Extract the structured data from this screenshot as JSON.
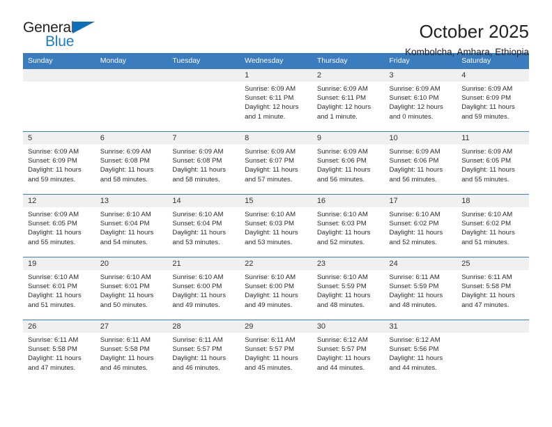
{
  "brand": {
    "name_top": "General",
    "name_bottom": "Blue",
    "flag_icon": "blue-triangle-flag",
    "accent_color": "#1a7ec8",
    "header_color": "#3a7cbe"
  },
  "header": {
    "month_title": "October 2025",
    "location": "Kombolcha, Amhara, Ethiopia"
  },
  "weekdays": [
    "Sunday",
    "Monday",
    "Tuesday",
    "Wednesday",
    "Thursday",
    "Friday",
    "Saturday"
  ],
  "weeks": [
    [
      {
        "day": "",
        "empty": true
      },
      {
        "day": "",
        "empty": true
      },
      {
        "day": "",
        "empty": true
      },
      {
        "day": "1",
        "sunrise": "Sunrise: 6:09 AM",
        "sunset": "Sunset: 6:11 PM",
        "daylight": "Daylight: 12 hours and 1 minute."
      },
      {
        "day": "2",
        "sunrise": "Sunrise: 6:09 AM",
        "sunset": "Sunset: 6:11 PM",
        "daylight": "Daylight: 12 hours and 1 minute."
      },
      {
        "day": "3",
        "sunrise": "Sunrise: 6:09 AM",
        "sunset": "Sunset: 6:10 PM",
        "daylight": "Daylight: 12 hours and 0 minutes."
      },
      {
        "day": "4",
        "sunrise": "Sunrise: 6:09 AM",
        "sunset": "Sunset: 6:09 PM",
        "daylight": "Daylight: 11 hours and 59 minutes."
      }
    ],
    [
      {
        "day": "5",
        "sunrise": "Sunrise: 6:09 AM",
        "sunset": "Sunset: 6:09 PM",
        "daylight": "Daylight: 11 hours and 59 minutes."
      },
      {
        "day": "6",
        "sunrise": "Sunrise: 6:09 AM",
        "sunset": "Sunset: 6:08 PM",
        "daylight": "Daylight: 11 hours and 58 minutes."
      },
      {
        "day": "7",
        "sunrise": "Sunrise: 6:09 AM",
        "sunset": "Sunset: 6:08 PM",
        "daylight": "Daylight: 11 hours and 58 minutes."
      },
      {
        "day": "8",
        "sunrise": "Sunrise: 6:09 AM",
        "sunset": "Sunset: 6:07 PM",
        "daylight": "Daylight: 11 hours and 57 minutes."
      },
      {
        "day": "9",
        "sunrise": "Sunrise: 6:09 AM",
        "sunset": "Sunset: 6:06 PM",
        "daylight": "Daylight: 11 hours and 56 minutes."
      },
      {
        "day": "10",
        "sunrise": "Sunrise: 6:09 AM",
        "sunset": "Sunset: 6:06 PM",
        "daylight": "Daylight: 11 hours and 56 minutes."
      },
      {
        "day": "11",
        "sunrise": "Sunrise: 6:09 AM",
        "sunset": "Sunset: 6:05 PM",
        "daylight": "Daylight: 11 hours and 55 minutes."
      }
    ],
    [
      {
        "day": "12",
        "sunrise": "Sunrise: 6:09 AM",
        "sunset": "Sunset: 6:05 PM",
        "daylight": "Daylight: 11 hours and 55 minutes."
      },
      {
        "day": "13",
        "sunrise": "Sunrise: 6:10 AM",
        "sunset": "Sunset: 6:04 PM",
        "daylight": "Daylight: 11 hours and 54 minutes."
      },
      {
        "day": "14",
        "sunrise": "Sunrise: 6:10 AM",
        "sunset": "Sunset: 6:04 PM",
        "daylight": "Daylight: 11 hours and 53 minutes."
      },
      {
        "day": "15",
        "sunrise": "Sunrise: 6:10 AM",
        "sunset": "Sunset: 6:03 PM",
        "daylight": "Daylight: 11 hours and 53 minutes."
      },
      {
        "day": "16",
        "sunrise": "Sunrise: 6:10 AM",
        "sunset": "Sunset: 6:03 PM",
        "daylight": "Daylight: 11 hours and 52 minutes."
      },
      {
        "day": "17",
        "sunrise": "Sunrise: 6:10 AM",
        "sunset": "Sunset: 6:02 PM",
        "daylight": "Daylight: 11 hours and 52 minutes."
      },
      {
        "day": "18",
        "sunrise": "Sunrise: 6:10 AM",
        "sunset": "Sunset: 6:02 PM",
        "daylight": "Daylight: 11 hours and 51 minutes."
      }
    ],
    [
      {
        "day": "19",
        "sunrise": "Sunrise: 6:10 AM",
        "sunset": "Sunset: 6:01 PM",
        "daylight": "Daylight: 11 hours and 51 minutes."
      },
      {
        "day": "20",
        "sunrise": "Sunrise: 6:10 AM",
        "sunset": "Sunset: 6:01 PM",
        "daylight": "Daylight: 11 hours and 50 minutes."
      },
      {
        "day": "21",
        "sunrise": "Sunrise: 6:10 AM",
        "sunset": "Sunset: 6:00 PM",
        "daylight": "Daylight: 11 hours and 49 minutes."
      },
      {
        "day": "22",
        "sunrise": "Sunrise: 6:10 AM",
        "sunset": "Sunset: 6:00 PM",
        "daylight": "Daylight: 11 hours and 49 minutes."
      },
      {
        "day": "23",
        "sunrise": "Sunrise: 6:10 AM",
        "sunset": "Sunset: 5:59 PM",
        "daylight": "Daylight: 11 hours and 48 minutes."
      },
      {
        "day": "24",
        "sunrise": "Sunrise: 6:11 AM",
        "sunset": "Sunset: 5:59 PM",
        "daylight": "Daylight: 11 hours and 48 minutes."
      },
      {
        "day": "25",
        "sunrise": "Sunrise: 6:11 AM",
        "sunset": "Sunset: 5:58 PM",
        "daylight": "Daylight: 11 hours and 47 minutes."
      }
    ],
    [
      {
        "day": "26",
        "sunrise": "Sunrise: 6:11 AM",
        "sunset": "Sunset: 5:58 PM",
        "daylight": "Daylight: 11 hours and 47 minutes."
      },
      {
        "day": "27",
        "sunrise": "Sunrise: 6:11 AM",
        "sunset": "Sunset: 5:58 PM",
        "daylight": "Daylight: 11 hours and 46 minutes."
      },
      {
        "day": "28",
        "sunrise": "Sunrise: 6:11 AM",
        "sunset": "Sunset: 5:57 PM",
        "daylight": "Daylight: 11 hours and 46 minutes."
      },
      {
        "day": "29",
        "sunrise": "Sunrise: 6:11 AM",
        "sunset": "Sunset: 5:57 PM",
        "daylight": "Daylight: 11 hours and 45 minutes."
      },
      {
        "day": "30",
        "sunrise": "Sunrise: 6:12 AM",
        "sunset": "Sunset: 5:57 PM",
        "daylight": "Daylight: 11 hours and 44 minutes."
      },
      {
        "day": "31",
        "sunrise": "Sunrise: 6:12 AM",
        "sunset": "Sunset: 5:56 PM",
        "daylight": "Daylight: 11 hours and 44 minutes."
      },
      {
        "day": "",
        "empty": true
      }
    ]
  ]
}
